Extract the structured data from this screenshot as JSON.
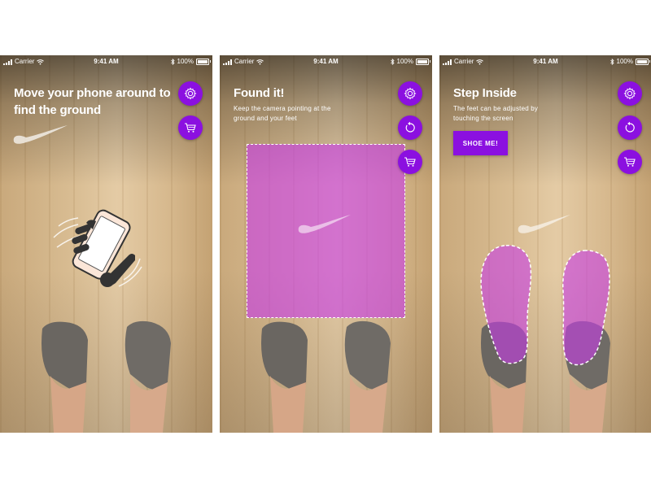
{
  "status_bar": {
    "carrier": "Carrier",
    "time": "9:41 AM",
    "battery": "100%"
  },
  "screens": [
    {
      "title_line1": "Move your phone around to",
      "title_line2": "find the ground"
    },
    {
      "title": "Found it!",
      "subtitle_line1": "Keep the camera pointing at the",
      "subtitle_line2": "ground and your feet"
    },
    {
      "title": "Step Inside",
      "subtitle_line1": "The feet can be adjusted by",
      "subtitle_line2": "touching the screen",
      "button": "SHOE ME!"
    }
  ],
  "icons": {
    "settings": "gear-icon",
    "cart": "cart-icon",
    "reset": "refresh-icon",
    "logo": "swoosh-logo",
    "hint": "phone-in-hand-icon"
  },
  "colors": {
    "accent": "#8b10e0",
    "overlay": "#c83ce6",
    "text": "#ffffff"
  }
}
